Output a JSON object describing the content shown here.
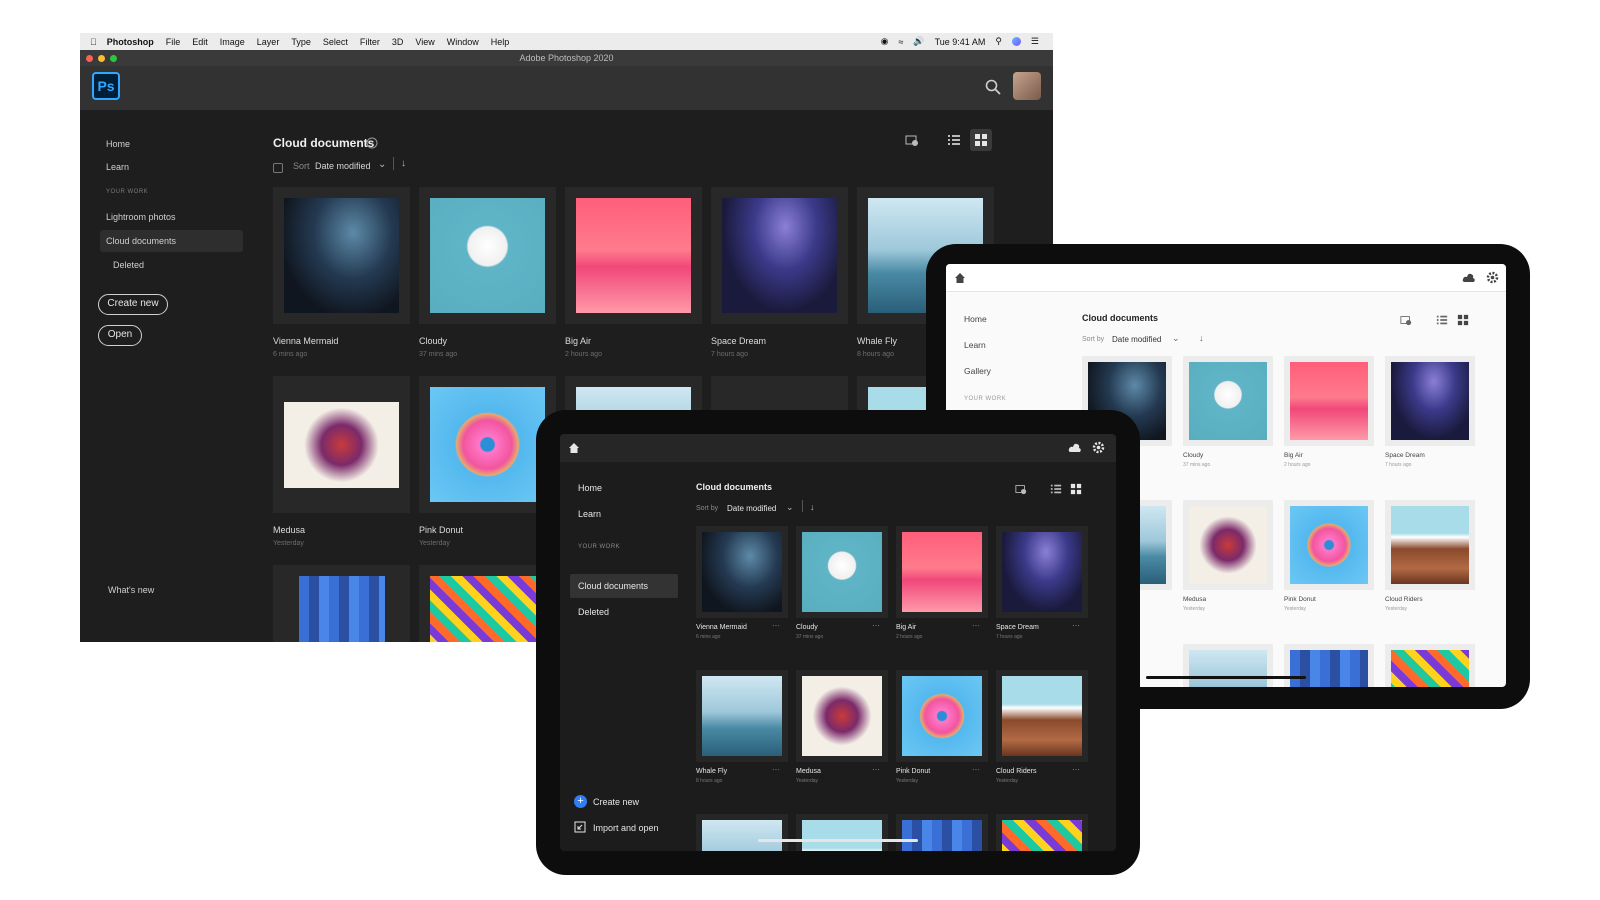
{
  "desktop": {
    "menubar": {
      "app": "Photoshop",
      "menus": [
        "File",
        "Edit",
        "Image",
        "Layer",
        "Type",
        "Select",
        "Filter",
        "3D",
        "View",
        "Window",
        "Help"
      ],
      "clock": "Tue 9:41 AM"
    },
    "window_title": "Adobe Photoshop 2020",
    "logo_text": "Ps",
    "sidebar": {
      "home": "Home",
      "learn": "Learn",
      "section_label": "YOUR WORK",
      "lightroom": "Lightroom photos",
      "cloud_docs": "Cloud documents",
      "deleted": "Deleted",
      "create_new": "Create new",
      "open": "Open",
      "whats_new": "What's new"
    },
    "main": {
      "title": "Cloud documents",
      "sort_label": "Sort",
      "sort_value": "Date modified"
    },
    "docs": [
      {
        "name": "Vienna Mermaid",
        "time": "6 mins ago"
      },
      {
        "name": "Cloudy",
        "time": "37 mins ago"
      },
      {
        "name": "Big Air",
        "time": "2 hours ago"
      },
      {
        "name": "Space Dream",
        "time": "7 hours ago"
      },
      {
        "name": "Whale Fly",
        "time": "8 hours ago"
      },
      {
        "name": "Medusa",
        "time": "Yesterday"
      },
      {
        "name": "Pink Donut",
        "time": "Yesterday"
      }
    ]
  },
  "tablet_light": {
    "sidebar": {
      "home": "Home",
      "learn": "Learn",
      "gallery": "Gallery",
      "section_label": "YOUR WORK"
    },
    "title": "Cloud documents",
    "sort_label": "Sort by",
    "sort_value": "Date modified",
    "docs": [
      {
        "name": "Cloudy",
        "time": "37 mins ago"
      },
      {
        "name": "Big Air",
        "time": "2 hours ago"
      },
      {
        "name": "Space Dream",
        "time": "7 hours ago"
      },
      {
        "name": "Medusa",
        "time": "Yesterday"
      },
      {
        "name": "Pink Donut",
        "time": "Yesterday"
      },
      {
        "name": "Cloud Riders",
        "time": "Yesterday"
      }
    ]
  },
  "tablet_dark": {
    "sidebar": {
      "home": "Home",
      "learn": "Learn",
      "section_label": "YOUR WORK",
      "cloud_docs": "Cloud documents",
      "deleted": "Deleted",
      "create_new": "Create new",
      "import_open": "Import and open"
    },
    "title": "Cloud documents",
    "sort_label": "Sort by",
    "sort_value": "Date modified",
    "docs": [
      {
        "name": "Vienna Mermaid",
        "time": "6 mins ago"
      },
      {
        "name": "Cloudy",
        "time": "37 mins ago"
      },
      {
        "name": "Big Air",
        "time": "2 hours ago"
      },
      {
        "name": "Space Dream",
        "time": "7 hours ago"
      },
      {
        "name": "Whale Fly",
        "time": "8 hours ago"
      },
      {
        "name": "Medusa",
        "time": "Yesterday"
      },
      {
        "name": "Pink Donut",
        "time": "Yesterday"
      },
      {
        "name": "Cloud Riders",
        "time": "Yesterday"
      }
    ],
    "more_label": "···"
  },
  "colors": {
    "ps_blue": "#31a8ff",
    "dark_bg": "#1e1e1e",
    "light_bg": "#fafafa"
  }
}
